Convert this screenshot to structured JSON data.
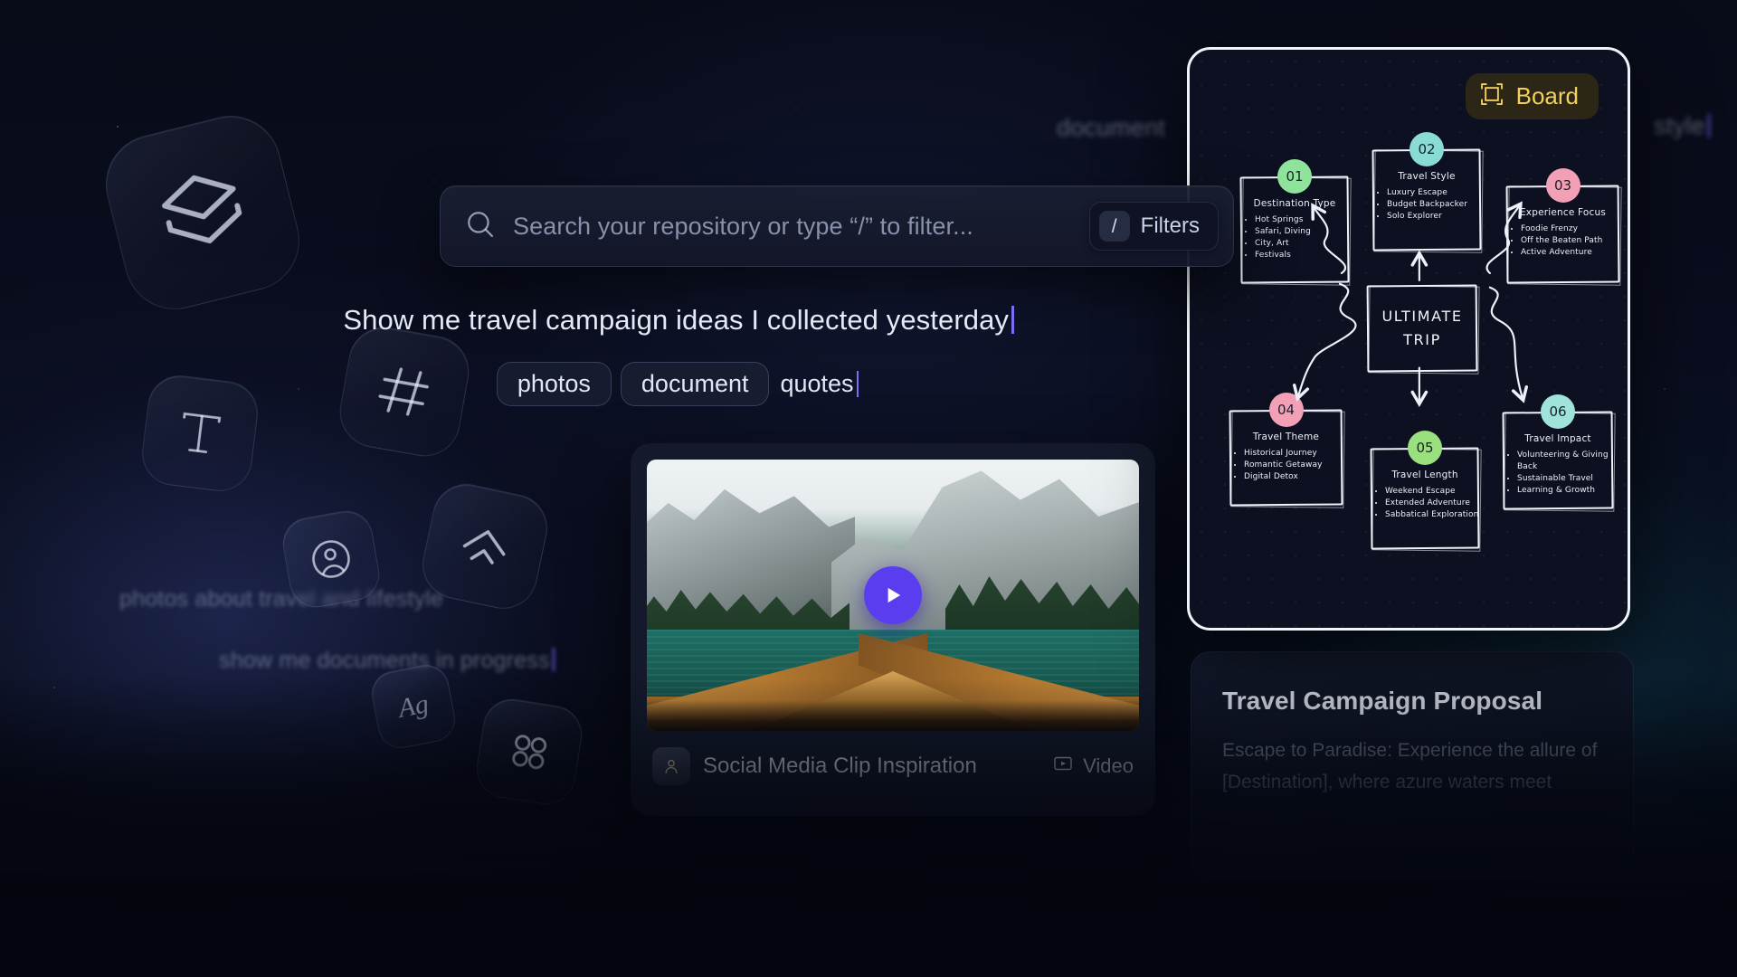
{
  "background_prompts": {
    "top_left": "document",
    "top_right": "style",
    "mid_left": "photos about travel and lifestyle",
    "mid_left_2": "show me documents in progress"
  },
  "floating_icons": [
    {
      "name": "layers-icon",
      "label": "layers"
    },
    {
      "name": "text-tool-icon",
      "label": "T"
    },
    {
      "name": "hashtag-icon",
      "label": "#"
    },
    {
      "name": "user-icon",
      "label": "user"
    },
    {
      "name": "chevron-up-icon",
      "label": "chevron up"
    },
    {
      "name": "font-sample-icon",
      "label": "Ag"
    },
    {
      "name": "dots-grid-icon",
      "label": "apps"
    }
  ],
  "search": {
    "placeholder": "Search your repository or type “/” to filter...",
    "icon": "search-icon",
    "filters_key": "/",
    "filters_label": "Filters"
  },
  "query": {
    "typed_text": "Show me travel campaign ideas I collected yesterday",
    "chips": [
      {
        "label": "photos",
        "style": "pill"
      },
      {
        "label": "document",
        "style": "pill"
      },
      {
        "label": "quotes",
        "style": "plain"
      }
    ]
  },
  "video_card": {
    "title": "Social Media Clip Inspiration",
    "type_label": "Video",
    "type_icon": "video-icon",
    "play_icon": "play-icon",
    "avatar_icon": "avatar-icon",
    "thumbnail_alt": "Wooden boat bow on a turquoise alpine lake with mountains"
  },
  "board": {
    "badge_label": "Board",
    "badge_icon": "frame-select-icon",
    "badge_color": "#f3cf5e",
    "center_node": {
      "line1": "ULTIMATE",
      "line2": "TRIP"
    },
    "nodes": [
      {
        "number": "01",
        "color": "#8fe39a",
        "title": "Destination Type",
        "items": [
          "Hot Springs",
          "Safari, Diving",
          "City, Art",
          "Festivals"
        ]
      },
      {
        "number": "02",
        "color": "#89dcd4",
        "title": "Travel Style",
        "items": [
          "Luxury Escape",
          "Budget Backpacker",
          "Solo Explorer"
        ]
      },
      {
        "number": "03",
        "color": "#f2a0b6",
        "title": "Experience Focus",
        "items": [
          "Foodie Frenzy",
          "Off the Beaten Path",
          "Active Adventure"
        ]
      },
      {
        "number": "04",
        "color": "#f2a0b6",
        "title": "Travel Theme",
        "items": [
          "Historical Journey",
          "Romantic Getaway",
          "Digital Detox"
        ]
      },
      {
        "number": "05",
        "color": "#9be07f",
        "title": "Travel Length",
        "items": [
          "Weekend Escape",
          "Extended Adventure",
          "Sabbatical Exploration"
        ]
      },
      {
        "number": "06",
        "color": "#9fe3da",
        "title": "Travel Impact",
        "items": [
          "Volunteering & Giving Back",
          "Sustainable Travel",
          "Learning & Growth"
        ]
      }
    ]
  },
  "proposal_card": {
    "title": "Travel Campaign Proposal",
    "body": "Escape to Paradise: Experience the allure of [Destination], where azure waters meet"
  },
  "theme": {
    "accent_purple": "#5b3df0",
    "accent_yellow": "#f3cf5e",
    "background": "#04060f",
    "panel": "#0c1020"
  }
}
